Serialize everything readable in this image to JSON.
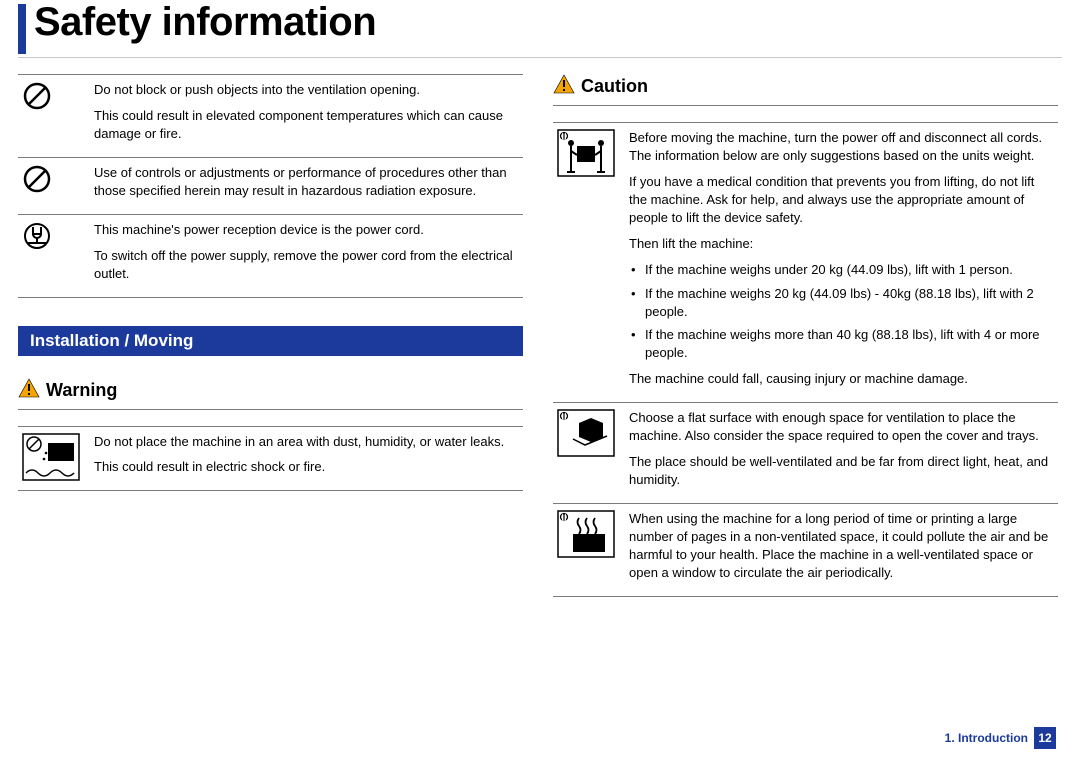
{
  "page_title": "Safety information",
  "left_column": {
    "table": [
      {
        "icon": "prohibit",
        "lines": [
          "Do not block or push objects into the ventilation opening.",
          "This could result in elevated component temperatures which can cause damage or fire."
        ]
      },
      {
        "icon": "prohibit",
        "lines": [
          "Use of controls or adjustments or performance of procedures other than those specified herein may result in hazardous radiation exposure."
        ]
      },
      {
        "icon": "plug",
        "lines": [
          "This machine's power reception device is the power cord.",
          "To switch off the power supply, remove the power cord from the electrical outlet."
        ]
      }
    ],
    "section_heading": "Installation / Moving",
    "warning_label": "Warning",
    "warning_table": [
      {
        "icon": "no-water",
        "lines": [
          "Do not place the machine in an area with dust, humidity, or water leaks.",
          "This could result in electric shock or fire."
        ]
      }
    ]
  },
  "right_column": {
    "caution_label": "Caution",
    "caution_table": [
      {
        "icon": "two-lift",
        "paras": [
          "Before moving the machine, turn the power off and disconnect all cords. The information below are only suggestions based on the units weight.",
          "If you have a medical condition that prevents you from lifting, do not lift the machine. Ask for help, and always use the appropriate amount of people to lift the device safety.",
          "Then lift the machine:"
        ],
        "bullets": [
          "If the machine weighs under 20 kg (44.09 lbs), lift with 1 person.",
          "If the machine weighs 20 kg (44.09 lbs) - 40kg (88.18 lbs), lift with 2 people.",
          "If the machine weighs more than 40 kg (88.18 lbs), lift with 4 or more people."
        ],
        "after": [
          "The machine could fall, causing injury or machine damage."
        ]
      },
      {
        "icon": "box-surface",
        "paras": [
          "Choose a flat surface with enough space for ventilation to place the machine. Also consider the space required to open the cover and trays.",
          "The place should be well-ventilated and be far from direct light, heat, and humidity."
        ],
        "bullets": [],
        "after": []
      },
      {
        "icon": "heat-waves",
        "paras": [
          "When using the machine for a long period of time or printing a large number of pages in a non-ventilated space, it could pollute the air and be harmful to your health. Place the machine  in a well-ventilated space or open a window to circulate the air periodically."
        ],
        "bullets": [],
        "after": []
      }
    ]
  },
  "footer": {
    "label": "1. Introduction",
    "page": "12"
  }
}
